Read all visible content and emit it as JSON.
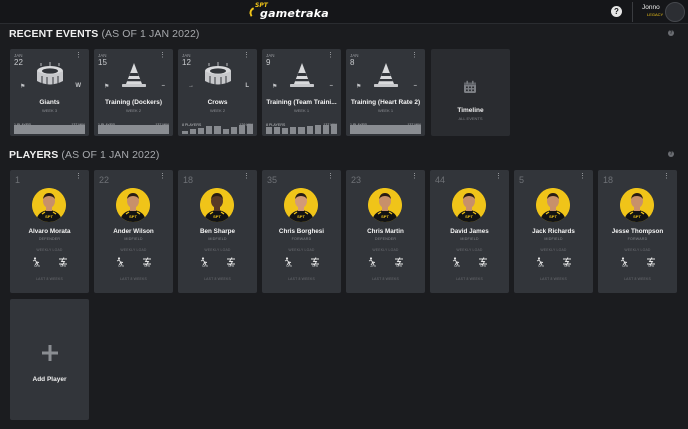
{
  "header": {
    "logo_brand": "SPT",
    "logo_name": "gametraka",
    "help_label": "?",
    "user_name": "Jonno",
    "user_team": "LEGACY"
  },
  "recent_events": {
    "title": "RECENT EVENTS",
    "subtitle": "(AS OF 1 JAN 2022)",
    "info_label": "?",
    "events": [
      {
        "month": "JAN",
        "day": "22",
        "icon": "stadium-icon",
        "left_marker": "⚑",
        "right_marker": "W",
        "title": "Giants",
        "week": "WEEK 3",
        "players": "1 PLAYER",
        "minutes": "137 MIN",
        "bars": []
      },
      {
        "month": "JAN",
        "day": "15",
        "icon": "training-cone-icon",
        "left_marker": "⚑",
        "right_marker": "–",
        "title": "Training (Dockers)",
        "week": "WEEK 2",
        "players": "1 PLAYER",
        "minutes": "137 MIN",
        "bars": []
      },
      {
        "month": "JAN",
        "day": "12",
        "icon": "stadium-icon",
        "left_marker": "→",
        "right_marker": "L",
        "title": "Crows",
        "week": "WEEK 2",
        "players": "8 PLAYERS",
        "minutes": "129 MIN",
        "bars": [
          0.35,
          0.55,
          0.65,
          0.8,
          0.85,
          0.5,
          0.75,
          0.9,
          1.0
        ]
      },
      {
        "month": "JAN",
        "day": "9",
        "icon": "training-cone-icon",
        "left_marker": "⚑",
        "right_marker": "–",
        "title": "Training (Team Traini...",
        "week": "WEEK 1",
        "players": "8 PLAYERS",
        "minutes": "137 MIN",
        "bars": [
          0.75,
          0.75,
          0.6,
          0.7,
          0.7,
          0.85,
          0.9,
          0.9,
          1.0
        ]
      },
      {
        "month": "JAN",
        "day": "8",
        "icon": "training-cone-icon",
        "left_marker": "⚑",
        "right_marker": "–",
        "title": "Training (Heart Rate 2)",
        "week": "WEEK 1",
        "players": "1 PLAYER",
        "minutes": "137 MIN",
        "bars": []
      }
    ],
    "timeline": {
      "title": "Timeline",
      "subtitle": "ALL EVENTS"
    }
  },
  "players_section": {
    "title": "PLAYERS",
    "subtitle": "(AS OF 1 JAN 2022)",
    "info_label": "?",
    "players": [
      {
        "number": "1",
        "name": "Alvaro Morata",
        "position": "DEFENDER",
        "load_label": "WEEKLY LOAD",
        "stat_left": "0m",
        "stat_right": "0m",
        "weeks_label": "LAST 8 WEEKS",
        "skin": "#c8906a"
      },
      {
        "number": "22",
        "name": "Ander Wilson",
        "position": "MIDFIELD",
        "load_label": "WEEKLY LOAD",
        "stat_left": "0m",
        "stat_right": "0m",
        "weeks_label": "LAST 8 WEEKS",
        "skin": "#c8906a"
      },
      {
        "number": "18",
        "name": "Ben Sharpe",
        "position": "MIDFIELD",
        "load_label": "WEEKLY LOAD",
        "stat_left": "0m",
        "stat_right": "0m",
        "weeks_label": "LAST 8 WEEKS",
        "skin": "#5a3a26"
      },
      {
        "number": "35",
        "name": "Chris Borghesi",
        "position": "FORWARD",
        "load_label": "WEEKLY LOAD",
        "stat_left": "0m",
        "stat_right": "0m",
        "weeks_label": "LAST 8 WEEKS",
        "skin": "#d39a78"
      },
      {
        "number": "23",
        "name": "Chris Martin",
        "position": "DEFENDER",
        "load_label": "WEEKLY LOAD",
        "stat_left": "2m",
        "stat_right": "0m",
        "weeks_label": "LAST 8 WEEKS",
        "skin": "#c8906a"
      },
      {
        "number": "44",
        "name": "David James",
        "position": "MIDFIELD",
        "load_label": "WEEKLY LOAD",
        "stat_left": "0m",
        "stat_right": "0m",
        "weeks_label": "LAST 8 WEEKS",
        "skin": "#c8906a"
      },
      {
        "number": "5",
        "name": "Jack Richards",
        "position": "MIDFIELD",
        "load_label": "WEEKLY LOAD",
        "stat_left": "0m",
        "stat_right": "0m",
        "weeks_label": "LAST 8 WEEKS",
        "skin": "#c8906a"
      },
      {
        "number": "18",
        "name": "Jesse Thompson",
        "position": "FORWARD",
        "load_label": "WEEKLY LOAD",
        "stat_left": "0m",
        "stat_right": "0m",
        "weeks_label": "LAST 8 WEEKS",
        "skin": "#c8906a"
      }
    ],
    "add_player_label": "Add Player"
  },
  "colors": {
    "accent": "#f0c419",
    "card": "#32353a",
    "background": "#1b1c1f"
  }
}
